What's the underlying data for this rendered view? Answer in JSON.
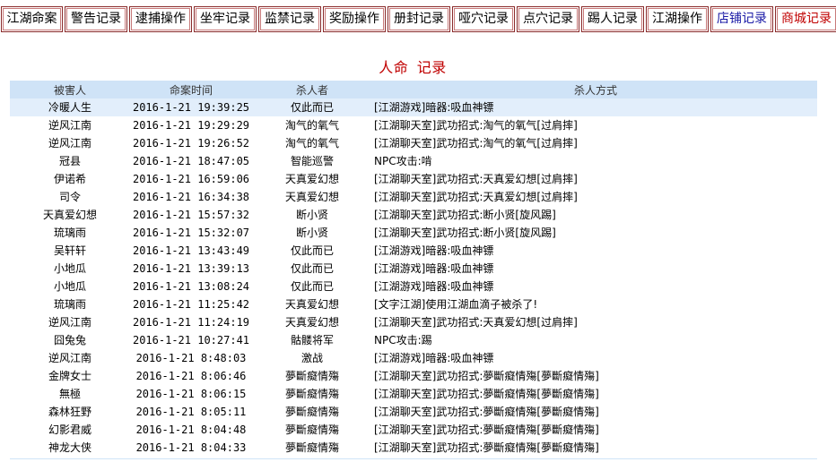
{
  "tabs": [
    {
      "label": "江湖命案",
      "color": "default"
    },
    {
      "label": "警告记录",
      "color": "default"
    },
    {
      "label": "逮捕操作",
      "color": "default"
    },
    {
      "label": "坐牢记录",
      "color": "default"
    },
    {
      "label": "监禁记录",
      "color": "default"
    },
    {
      "label": "奖励操作",
      "color": "default"
    },
    {
      "label": "册封记录",
      "color": "default"
    },
    {
      "label": "哑穴记录",
      "color": "default"
    },
    {
      "label": "点穴记录",
      "color": "default"
    },
    {
      "label": "踢人记录",
      "color": "default"
    },
    {
      "label": "江湖操作",
      "color": "default"
    },
    {
      "label": "店铺记录",
      "color": "blue"
    },
    {
      "label": "商城记录",
      "color": "red"
    }
  ],
  "title": "人命 记录",
  "table": {
    "headers": {
      "victim": "被害人",
      "time": "命案时间",
      "killer": "杀人者",
      "method": "杀人方式"
    },
    "rows": [
      {
        "victim": "冷暖人生",
        "time": "2016-1-21 19:39:25",
        "killer": "仅此而已",
        "method": "[江湖游戏]暗器:吸血神镖"
      },
      {
        "victim": "逆风江南",
        "time": "2016-1-21 19:29:29",
        "killer": "淘气的氧气",
        "method": "[江湖聊天室]武功招式:淘气的氧气[过肩摔]"
      },
      {
        "victim": "逆风江南",
        "time": "2016-1-21 19:26:52",
        "killer": "淘气的氧气",
        "method": "[江湖聊天室]武功招式:淘气的氧气[过肩摔]"
      },
      {
        "victim": "冠县",
        "time": "2016-1-21 18:47:05",
        "killer": "智能巡警",
        "method": "NPC攻击:啃"
      },
      {
        "victim": "伊诺希",
        "time": "2016-1-21 16:59:06",
        "killer": "天真爱幻想",
        "method": "[江湖聊天室]武功招式:天真爱幻想[过肩摔]"
      },
      {
        "victim": "司令",
        "time": "2016-1-21 16:34:38",
        "killer": "天真爱幻想",
        "method": "[江湖聊天室]武功招式:天真爱幻想[过肩摔]"
      },
      {
        "victim": "天真爱幻想",
        "time": "2016-1-21 15:57:32",
        "killer": "断小贤",
        "method": "[江湖聊天室]武功招式:断小贤[旋风踢]"
      },
      {
        "victim": "琉璃雨",
        "time": "2016-1-21 15:32:07",
        "killer": "断小贤",
        "method": "[江湖聊天室]武功招式:断小贤[旋风踢]"
      },
      {
        "victim": "吴轩轩",
        "time": "2016-1-21 13:43:49",
        "killer": "仅此而已",
        "method": "[江湖游戏]暗器:吸血神镖"
      },
      {
        "victim": "小地瓜",
        "time": "2016-1-21 13:39:13",
        "killer": "仅此而已",
        "method": "[江湖游戏]暗器:吸血神镖"
      },
      {
        "victim": "小地瓜",
        "time": "2016-1-21 13:08:24",
        "killer": "仅此而已",
        "method": "[江湖游戏]暗器:吸血神镖"
      },
      {
        "victim": "琉璃雨",
        "time": "2016-1-21 11:25:42",
        "killer": "天真爱幻想",
        "method": "[文字江湖]使用江湖血滴子被杀了!"
      },
      {
        "victim": "逆风江南",
        "time": "2016-1-21 11:24:19",
        "killer": "天真爱幻想",
        "method": "[江湖聊天室]武功招式:天真爱幻想[过肩摔]"
      },
      {
        "victim": "囧兔兔",
        "time": "2016-1-21 10:27:41",
        "killer": "骷髅将军",
        "method": "NPC攻击:踢"
      },
      {
        "victim": "逆风江南",
        "time": "2016-1-21 8:48:03",
        "killer": "激战",
        "method": "[江湖游戏]暗器:吸血神镖"
      },
      {
        "victim": "金牌女士",
        "time": "2016-1-21 8:06:46",
        "killer": "夢斷癡情殤",
        "method": "[江湖聊天室]武功招式:夢斷癡情殤[夢斷癡情殤]"
      },
      {
        "victim": "無極",
        "time": "2016-1-21 8:06:15",
        "killer": "夢斷癡情殤",
        "method": "[江湖聊天室]武功招式:夢斷癡情殤[夢斷癡情殤]"
      },
      {
        "victim": "森林狂野",
        "time": "2016-1-21 8:05:11",
        "killer": "夢斷癡情殤",
        "method": "[江湖聊天室]武功招式:夢斷癡情殤[夢斷癡情殤]"
      },
      {
        "victim": "幻影君威",
        "time": "2016-1-21 8:04:48",
        "killer": "夢斷癡情殤",
        "method": "[江湖聊天室]武功招式:夢斷癡情殤[夢斷癡情殤]"
      },
      {
        "victim": "神龙大侠",
        "time": "2016-1-21 8:04:33",
        "killer": "夢斷癡情殤",
        "method": "[江湖聊天室]武功招式:夢斷癡情殤[夢斷癡情殤]"
      }
    ]
  },
  "colors": {
    "tab_border": "#8a2b2b",
    "tab_blue_text": "#1a1aa6",
    "tab_red_text": "#c00000",
    "title": "#c00000",
    "header_bg": "#cfe3f7",
    "highlight_row_bg": "#e2eefb"
  }
}
